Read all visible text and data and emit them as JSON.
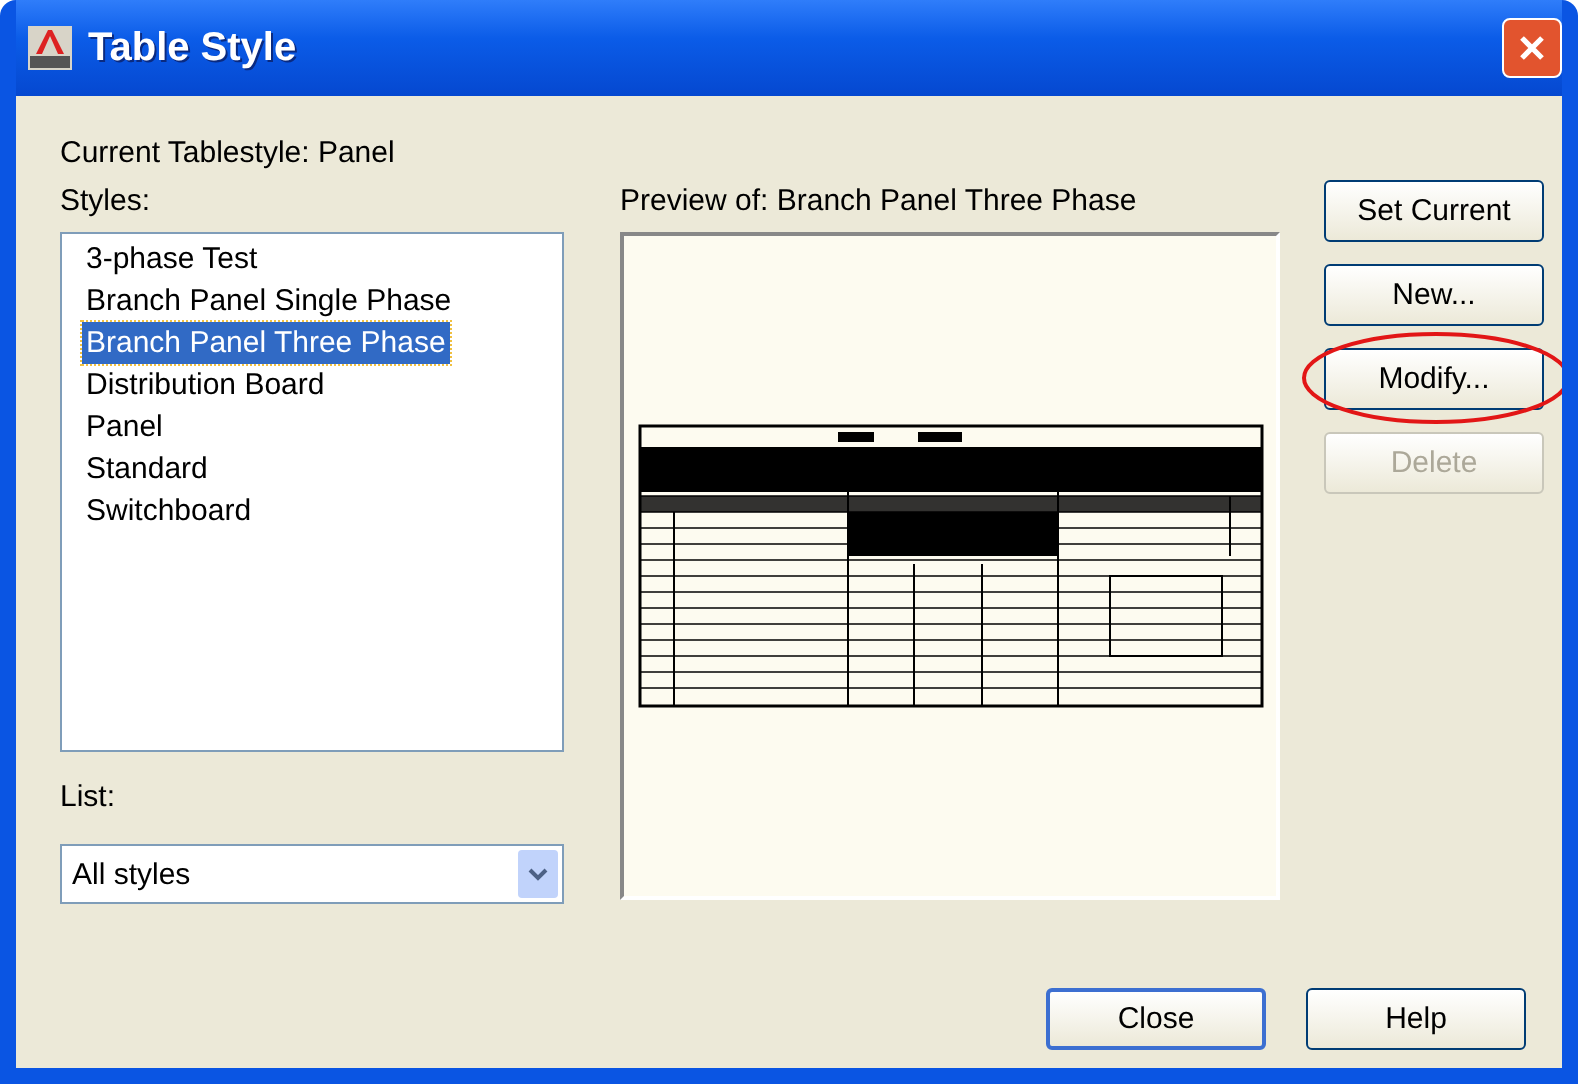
{
  "window": {
    "title": "Table Style"
  },
  "current_style": "Current Tablestyle: Panel",
  "styles": {
    "label": "Styles:",
    "items": [
      {
        "label": "3-phase Test",
        "selected": false
      },
      {
        "label": "Branch Panel Single Phase",
        "selected": false
      },
      {
        "label": "Branch Panel Three Phase",
        "selected": true
      },
      {
        "label": "Distribution Board",
        "selected": false
      },
      {
        "label": "Panel",
        "selected": false
      },
      {
        "label": "Standard",
        "selected": false
      },
      {
        "label": "Switchboard",
        "selected": false
      }
    ]
  },
  "list": {
    "label": "List:",
    "value": "All styles"
  },
  "preview": {
    "label": "Preview of: Branch Panel Three Phase"
  },
  "side_buttons": [
    {
      "label": "Set Current",
      "disabled": false,
      "highlighted": false
    },
    {
      "label": "New...",
      "disabled": false,
      "highlighted": false
    },
    {
      "label": "Modify...",
      "disabled": false,
      "highlighted": true
    },
    {
      "label": "Delete",
      "disabled": true,
      "highlighted": false
    }
  ],
  "bottom_buttons": [
    {
      "label": "Close",
      "default": true
    },
    {
      "label": "Help",
      "default": false
    }
  ]
}
